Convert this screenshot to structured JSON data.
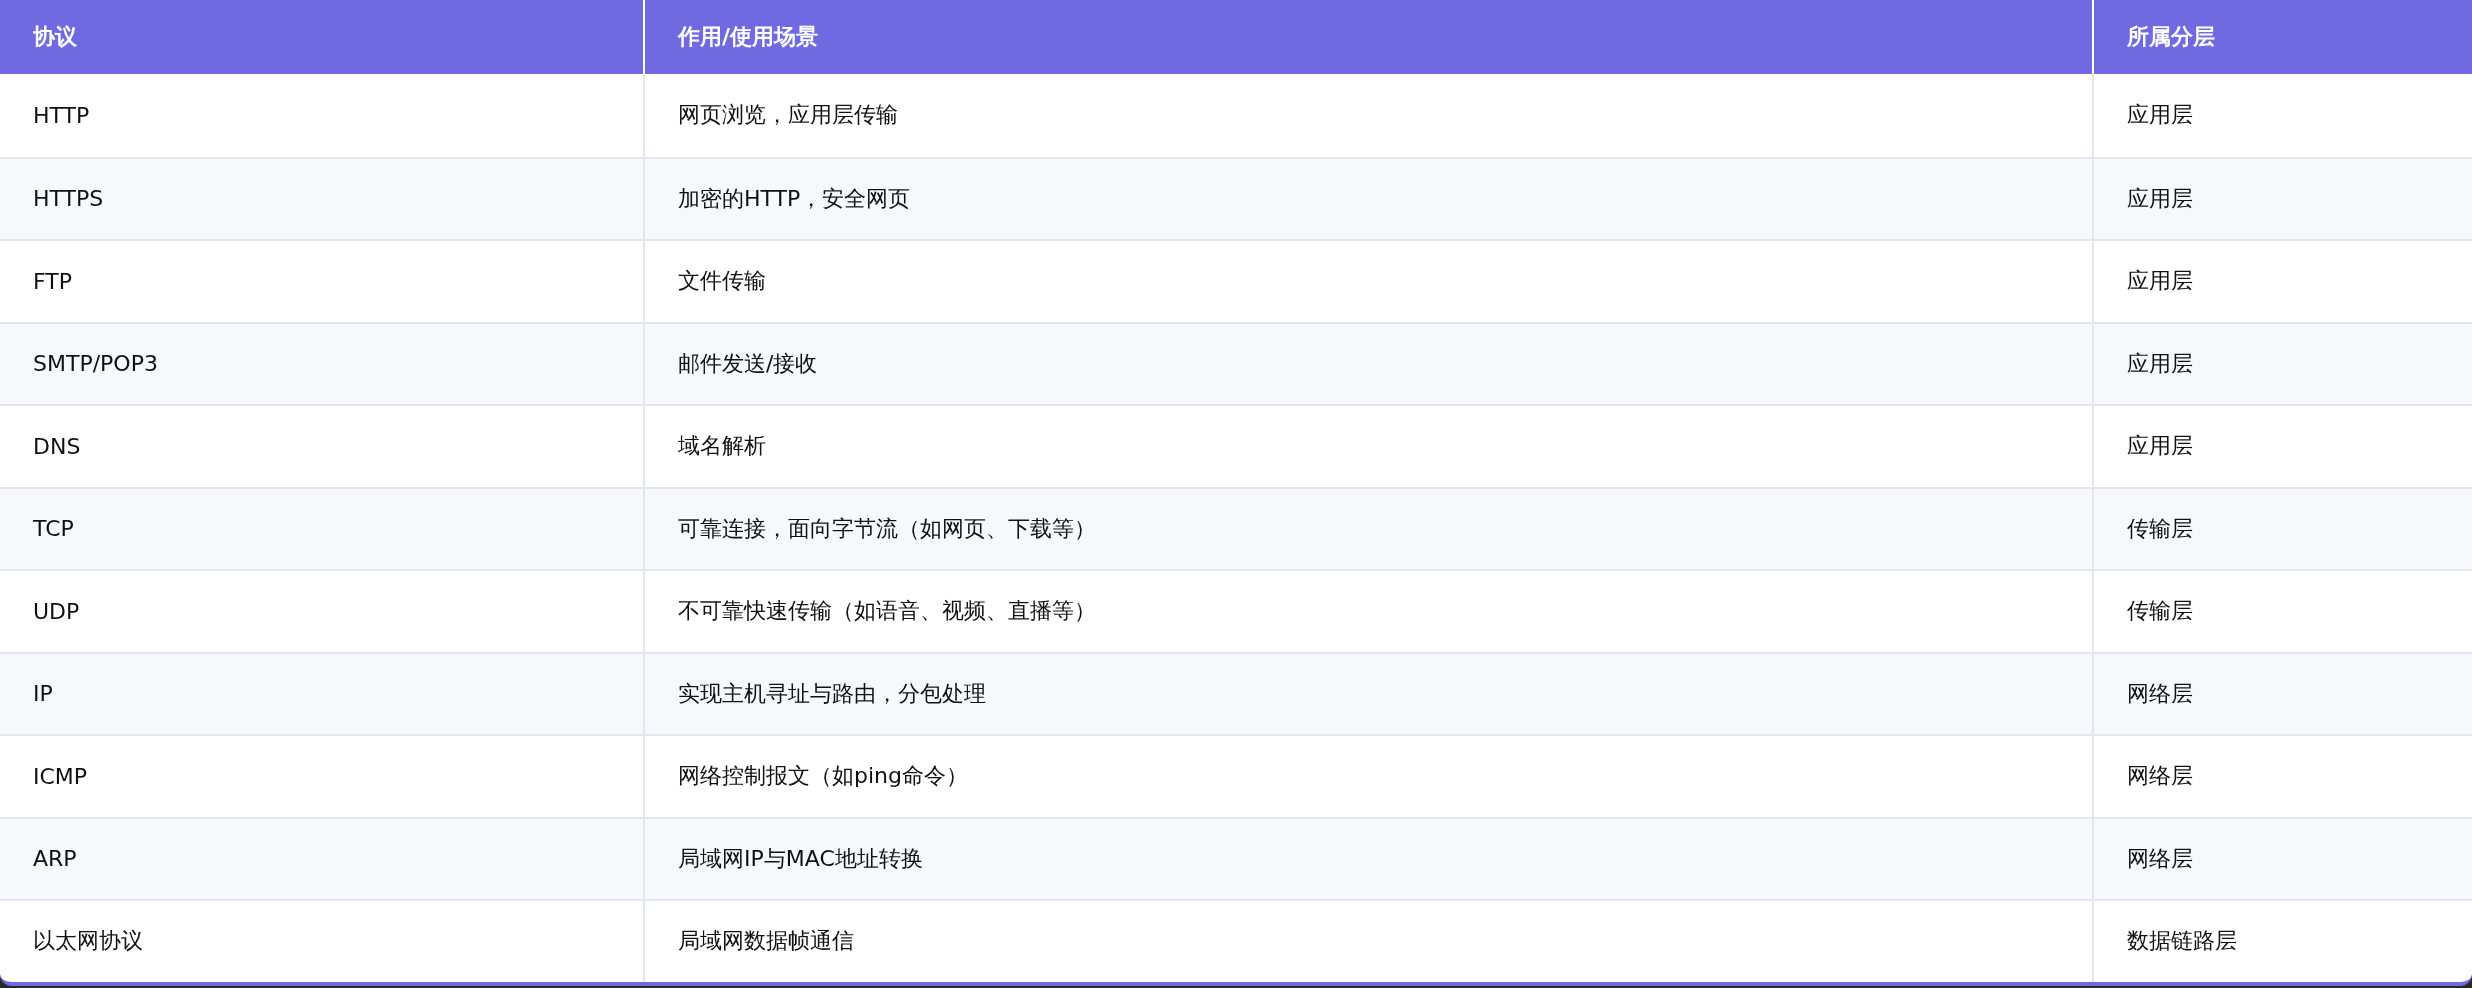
{
  "table": {
    "columns": [
      "协议",
      "作用/使用场景",
      "所属分层"
    ],
    "rows": [
      [
        "HTTP",
        "网页浏览，应用层传输",
        "应用层"
      ],
      [
        "HTTPS",
        "加密的HTTP，安全网页",
        "应用层"
      ],
      [
        "FTP",
        "文件传输",
        "应用层"
      ],
      [
        "SMTP/POP3",
        "邮件发送/接收",
        "应用层"
      ],
      [
        "DNS",
        "域名解析",
        "应用层"
      ],
      [
        "TCP",
        "可靠连接，面向字节流（如网页、下载等）",
        "传输层"
      ],
      [
        "UDP",
        "不可靠快速传输（如语音、视频、直播等）",
        "传输层"
      ],
      [
        "IP",
        "实现主机寻址与路由，分包处理",
        "网络层"
      ],
      [
        "ICMP",
        "网络控制报文（如ping命令）",
        "网络层"
      ],
      [
        "ARP",
        "局域网IP与MAC地址转换",
        "网络层"
      ],
      [
        "以太网协议",
        "局域网数据帧通信",
        "数据链路层"
      ]
    ]
  }
}
